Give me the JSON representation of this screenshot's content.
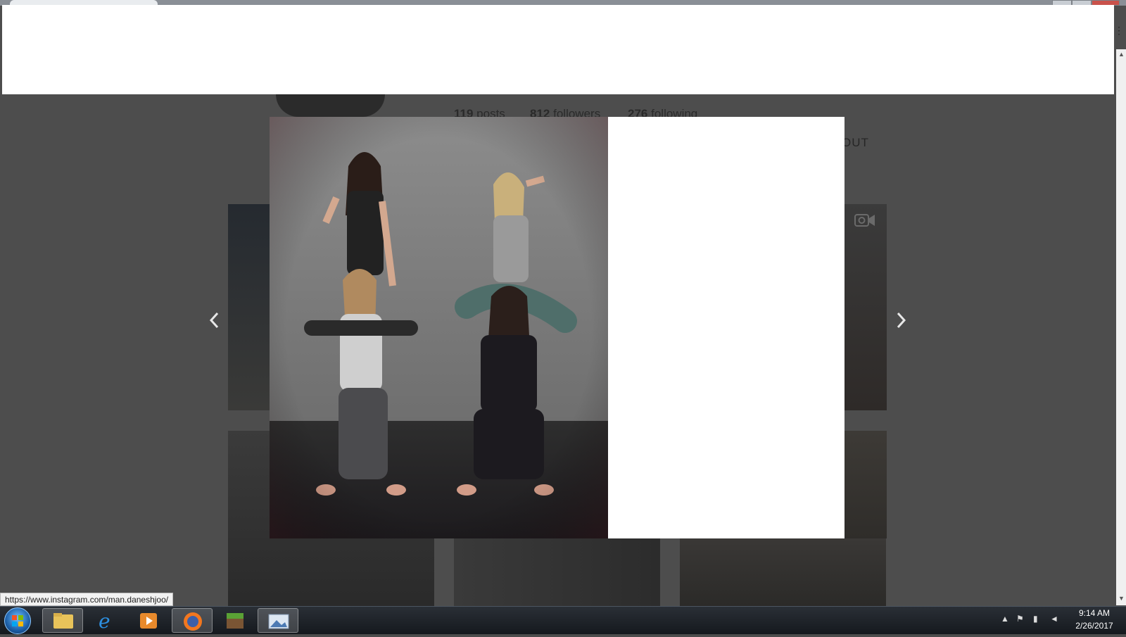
{
  "profile": {
    "stats": [
      {
        "num": "119",
        "label": "posts"
      },
      {
        "num": "812",
        "label": "followers"
      },
      {
        "num": "276",
        "label": "following"
      }
    ],
    "about_partial": "OUT"
  },
  "statusbar": {
    "url": "https://www.instagram.com/man.daneshjoo/"
  },
  "taskbar": {
    "time": "9:14 AM",
    "date": "2/26/2017"
  },
  "icons": {
    "prev": "chevron-left-icon",
    "next": "chevron-right-icon",
    "video": "video-camera-icon"
  },
  "colors": {
    "overlay": "#4d4d4d",
    "modal_bg": "#ffffff",
    "taskbar": "#15191e"
  }
}
